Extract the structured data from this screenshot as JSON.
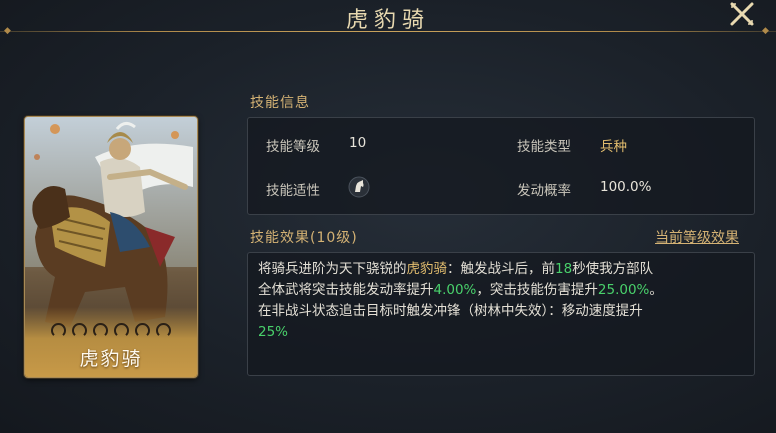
{
  "header": {
    "title": "虎豹骑"
  },
  "card": {
    "name": "虎豹骑"
  },
  "skill_info": {
    "section_title": "技能信息",
    "level_label": "技能等级",
    "level_value": "10",
    "type_label": "技能类型",
    "type_value": "兵种",
    "terrain_label": "技能适性",
    "terrain_icon": "horse-icon",
    "chance_label": "发动概率",
    "chance_value": "100.0%"
  },
  "skill_effect": {
    "section_title": "技能效果(10级)",
    "current_level_link": "当前等级效果",
    "line1_a": "将骑兵进阶为天下骁锐的",
    "line1_b": "虎豹骑",
    "line1_c": "：触发战斗后，前",
    "line1_d": "18",
    "line1_e": "秒使我方部队",
    "line2_a": "全体武将突击技能发动率提升",
    "line2_b": "4.00%",
    "line2_c": "，突击技能伤害提升",
    "line2_d": "25.00%",
    "line2_e": "。",
    "line3_a": "在非战斗状态追击目标时触发冲锋（树林中失效）：移动速度提升",
    "line3_b": "25%"
  },
  "colors": {
    "gold": "#e2bd6e",
    "green": "#49d06b",
    "accent": "#d4b274"
  }
}
